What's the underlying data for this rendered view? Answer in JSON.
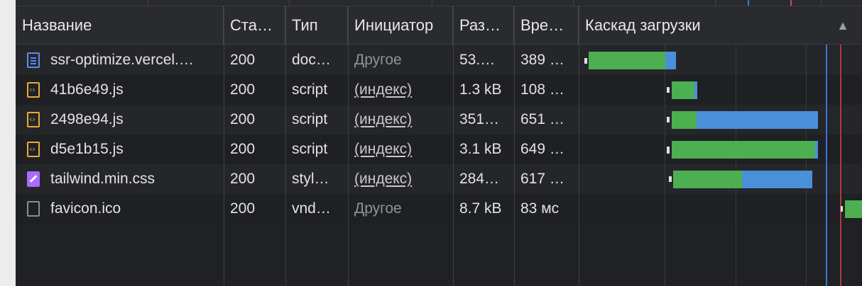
{
  "columns": {
    "name": "Название",
    "status": "Ста…",
    "type": "Тип",
    "initiator": "Инициатор",
    "size": "Раз…",
    "time": "Вре…",
    "waterfall": "Каскад загрузки"
  },
  "sort_icon": "▲",
  "colors": {
    "bar_green": "#4caf50",
    "bar_blue": "#4a90d9",
    "dom_marker": "#3b73d6",
    "load_marker": "#b23a3a"
  },
  "rows": [
    {
      "name": "ssr-optimize.vercel.…",
      "status": "200",
      "type": "doc…",
      "initiator": "Другое",
      "size": "53.…",
      "time": "389 …",
      "icon": "document-icon"
    },
    {
      "name": "41b6e49.js",
      "status": "200",
      "type": "script",
      "initiator": "(индекс)",
      "size": "1.3 kB",
      "time": "108 …",
      "icon": "script-icon"
    },
    {
      "name": "2498e94.js",
      "status": "200",
      "type": "script",
      "initiator": "(индекс)",
      "size": "351…",
      "time": "651 …",
      "icon": "script-icon"
    },
    {
      "name": "d5e1b15.js",
      "status": "200",
      "type": "script",
      "initiator": "(индекс)",
      "size": "3.1 kB",
      "time": "649 …",
      "icon": "script-icon"
    },
    {
      "name": "tailwind.min.css",
      "status": "200",
      "type": "styl…",
      "initiator": "(индекс)",
      "size": "284…",
      "time": "617 …",
      "icon": "stylesheet-icon"
    },
    {
      "name": "favicon.ico",
      "status": "200",
      "type": "vnd…",
      "initiator": "Другое",
      "size": "8.7 kB",
      "time": "83 мс",
      "icon": "file-icon"
    }
  ]
}
